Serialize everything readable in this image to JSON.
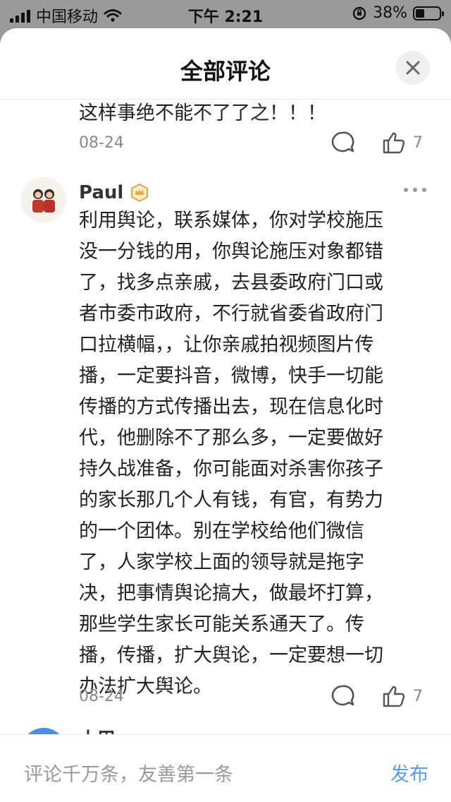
{
  "status_bar": {
    "carrier": "中国移动",
    "time": "下午 2:21",
    "battery": "38%"
  },
  "sheet": {
    "title": "全部评论"
  },
  "comments": [
    {
      "text": "这样事绝不能不了了之！！！",
      "date": "08-24",
      "likes": "7"
    },
    {
      "username": "Paul",
      "text_lines": [
        "利用舆论，联系媒体，你对学校施压",
        "没一分钱的用，你舆论施压对象都错",
        "了，找多点亲戚，去县委政府门口或",
        "者市委市政府，不行就省委省政府门",
        "口拉横幅，，让你亲戚拍视频图片传",
        "播，一定要抖音，微博，快手一切能",
        "传播的方式传播出去，现在信息化时",
        "代，他删除不了那么多，一定要做好",
        "持久战准备，你可能面对杀害你孩子",
        "的家长那几个人有钱，有官，有势力",
        "的一个团体。别在学校给他们微信",
        "了，人家学校上面的领导就是拖字",
        "决，把事情舆论搞大，做最坏打算，",
        "那些学生家长可能关系通天了。传",
        "播，传播，扩大舆论，一定要想一切",
        "办法扩大舆论。"
      ],
      "date": "08-24",
      "likes": "7"
    },
    {
      "username_partial": "大甲"
    }
  ],
  "input": {
    "placeholder": "评论千万条，友善第一条",
    "publish_label": "发布"
  },
  "icons": {
    "close": "close-icon",
    "reply": "comment-bubble-icon",
    "like": "thumbs-up-icon",
    "more": "more-dots-icon",
    "badge": "crown-badge-icon"
  },
  "colors": {
    "accent": "#5b9cf0",
    "badge": "#e0a84a"
  }
}
